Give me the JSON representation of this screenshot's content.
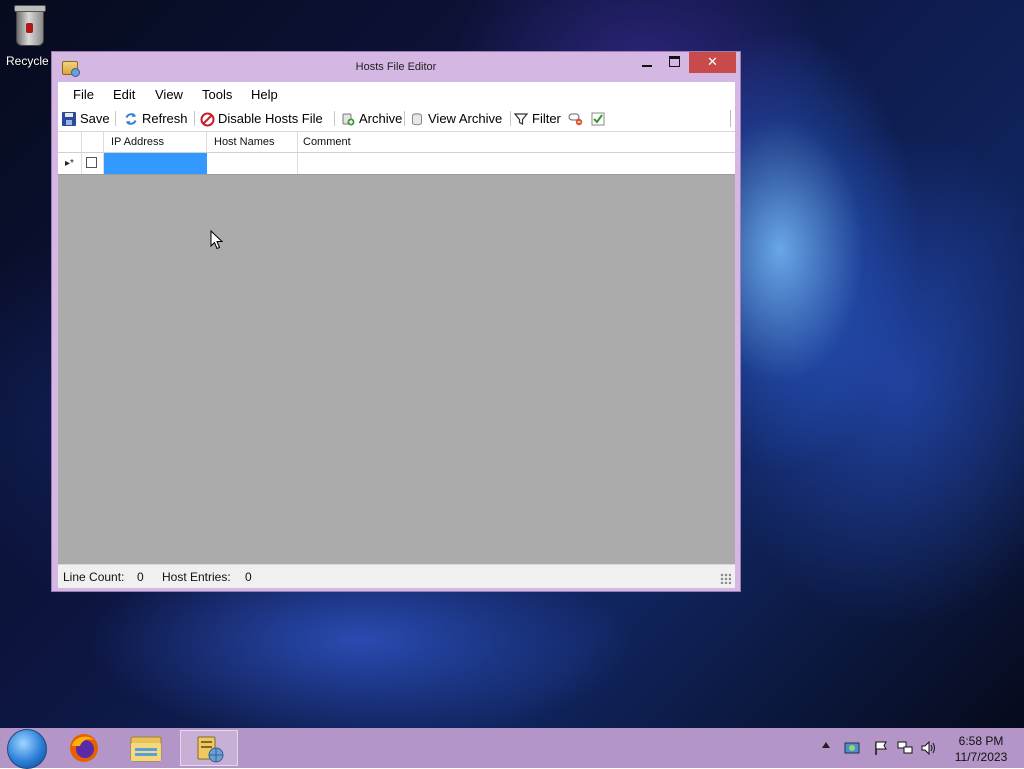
{
  "desktop": {
    "recycle_label": "Recycle"
  },
  "window": {
    "title": "Hosts File Editor",
    "close_glyph": "✕"
  },
  "menu": {
    "items": [
      "File",
      "Edit",
      "View",
      "Tools",
      "Help"
    ]
  },
  "toolbar": {
    "save": "Save",
    "refresh": "Refresh",
    "disable": "Disable Hosts File",
    "archive": "Archive",
    "view_archive": "View Archive",
    "filter": "Filter"
  },
  "grid": {
    "columns": [
      "IP Address",
      "Host Names",
      "Comment"
    ],
    "new_row_marker": "▸*"
  },
  "status": {
    "line_count_label": "Line Count:",
    "line_count": "0",
    "host_entries_label": "Host Entries:",
    "host_entries": "0"
  },
  "taskbar": {
    "time": "6:58 PM",
    "date": "11/7/2023"
  },
  "colors": {
    "window_frame": "#d4b7e3",
    "taskbar": "#b495c7",
    "selection": "#3399ff",
    "close_button": "#c94a4a"
  }
}
